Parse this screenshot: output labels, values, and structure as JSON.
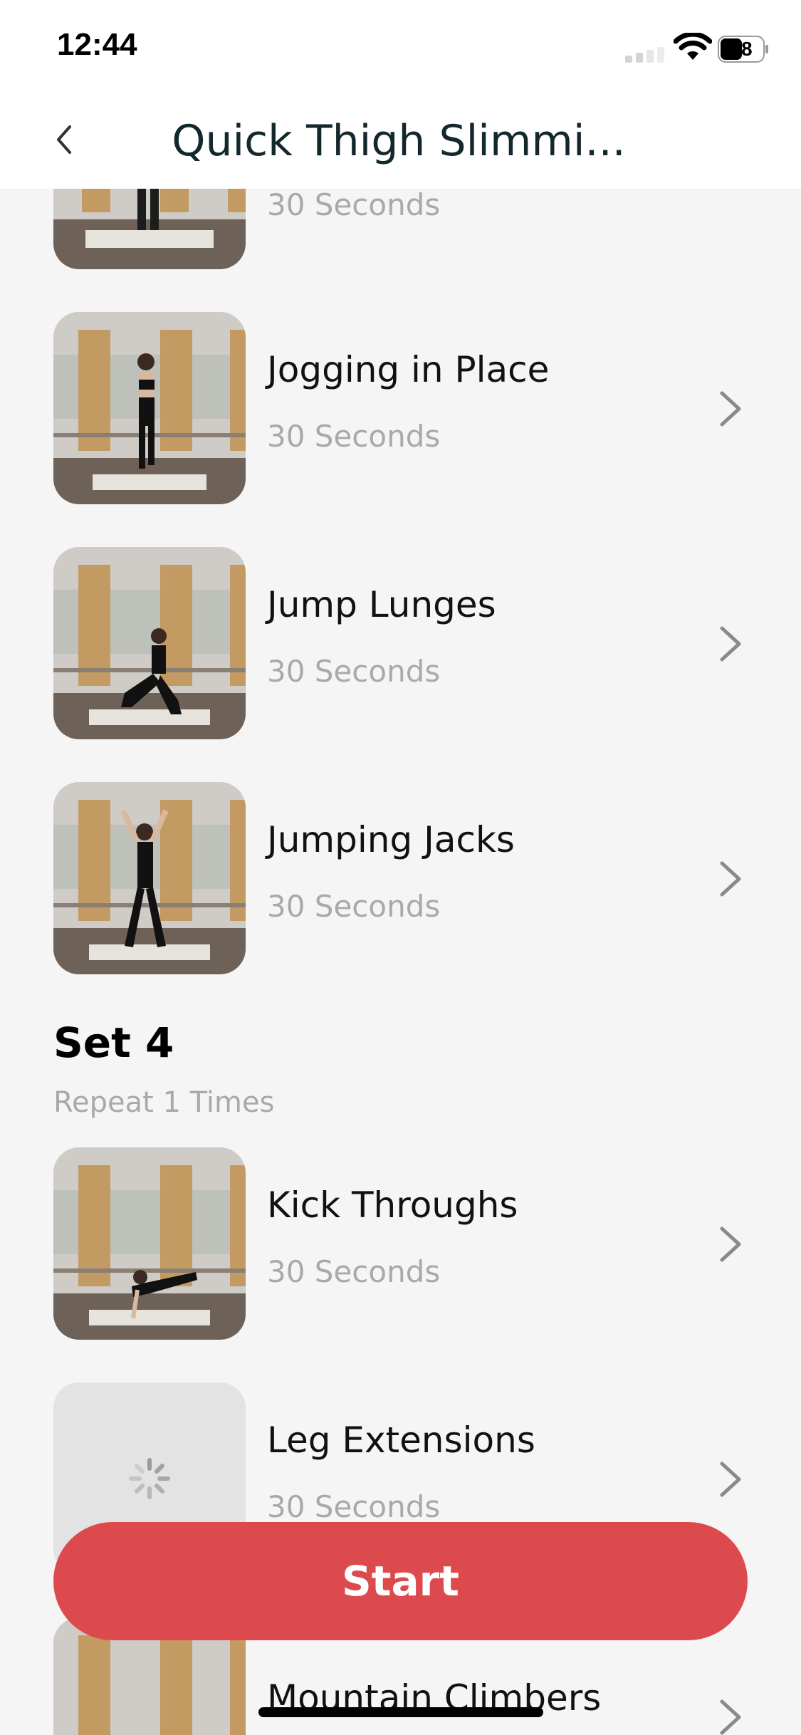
{
  "status_bar": {
    "time": "12:44",
    "battery": "48"
  },
  "header": {
    "title": "Quick Thigh Slimmi..."
  },
  "exercises_top": [
    {
      "name": "",
      "duration": "30 Seconds"
    },
    {
      "name": "Jogging in Place",
      "duration": "30 Seconds"
    },
    {
      "name": "Jump Lunges",
      "duration": "30 Seconds"
    },
    {
      "name": "Jumping Jacks",
      "duration": "30 Seconds"
    }
  ],
  "set": {
    "title": "Set 4",
    "subtitle": "Repeat 1 Times"
  },
  "exercises_set4": [
    {
      "name": "Kick Throughs",
      "duration": "30 Seconds"
    },
    {
      "name": "Leg Extensions",
      "duration": "30 Seconds"
    },
    {
      "name": "Mountain Climbers",
      "duration": ""
    }
  ],
  "start_button": {
    "label": "Start"
  },
  "colors": {
    "accent": "#dd4a4d",
    "title_text": "#13282c",
    "muted_text": "#a9a9a9",
    "background": "#f5f5f5"
  }
}
